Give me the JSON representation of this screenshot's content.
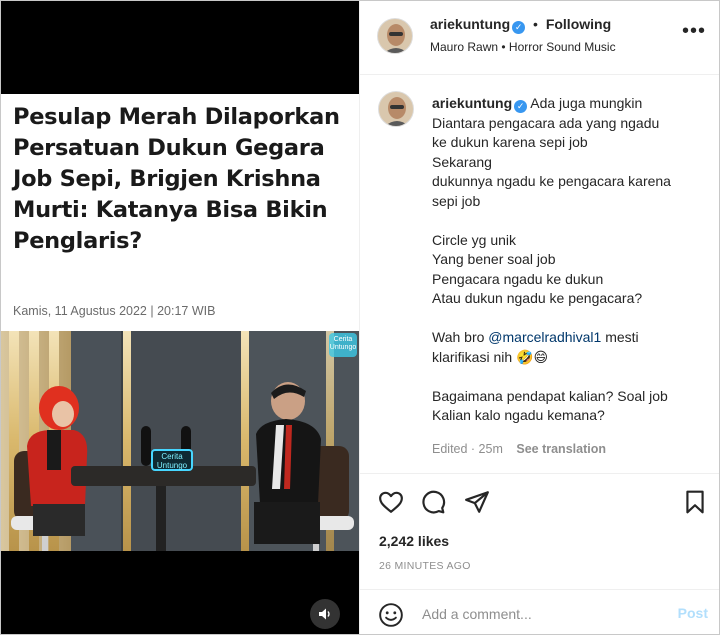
{
  "media": {
    "article_title": "Pesulap Merah Dilaporkan Persatuan Dukun Gegara Job Sepi, Brigjen Krishna Murti: Katanya Bisa Bikin Penglaris?",
    "article_date": "Kamis, 11 Agustus 2022 | 20:17 WIB",
    "video_sign": "Cerita Untungo",
    "video_watermark": "Cerita Untungo",
    "mute_icon": "speaker-icon"
  },
  "header": {
    "username": "ariekuntung",
    "separator": "•",
    "following_label": "Following",
    "subline": "Mauro Rawn • Horror Sound Music",
    "more_label": "•••"
  },
  "caption": {
    "username": "ariekuntung",
    "lines": [
      "Ada juga mungkin",
      "Diantara pengacara ada yang ngadu",
      "ke dukun karena sepi job",
      "Sekarang",
      "dukunnya ngadu ke pengacara karena",
      "sepi job",
      "",
      "Circle yg unik",
      "Yang bener soal job",
      "Pengacara ngadu ke dukun",
      "Atau dukun ngadu ke pengacara?",
      "",
      "Wah bro ",
      "klarifikasi nih 🤣😄",
      "",
      "Bagaimana pendapat kalian? Soal job",
      "Kalian kalo ngadu kemana?"
    ],
    "mention": "@marcelradhival1",
    "mention_suffix": " mesti",
    "edited": "Edited · 25m",
    "see_translation": "See translation"
  },
  "actions": {
    "icons": [
      "heart-icon",
      "comment-icon",
      "share-icon",
      "bookmark-icon"
    ]
  },
  "stats": {
    "likes": "2,242 likes",
    "time_ago": "26 MINUTES AGO"
  },
  "comment": {
    "placeholder": "Add a comment...",
    "post_label": "Post",
    "emoji_icon": "smiley-icon"
  },
  "colors": {
    "link": "#00376b",
    "verified": "#3897f0",
    "post_disabled": "#b2dffc",
    "muted": "#8e8e8e"
  }
}
